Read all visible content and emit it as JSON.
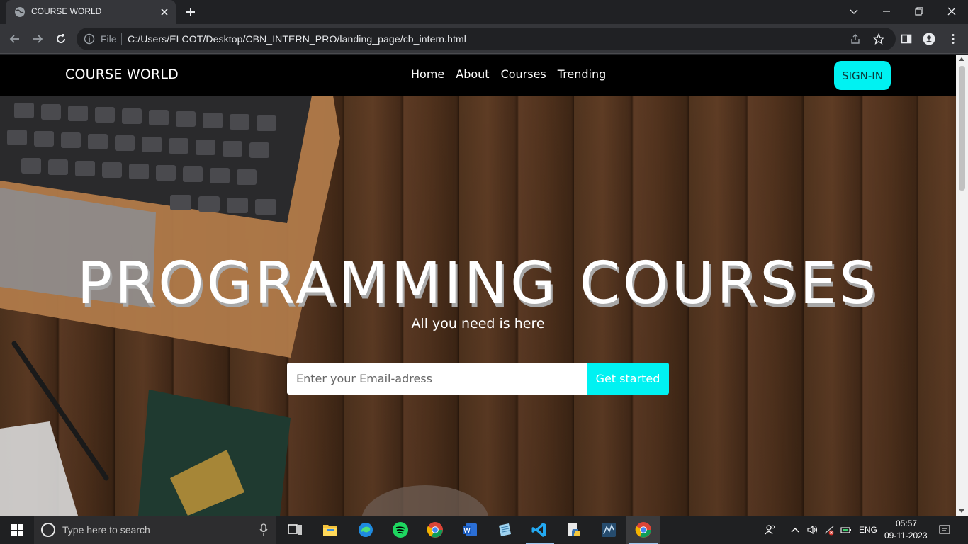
{
  "browser": {
    "tab_title": "COURSE WORLD",
    "address_scheme": "File",
    "address_url": "C:/Users/ELCOT/Desktop/CBN_INTERN_PRO/landing_page/cb_intern.html"
  },
  "site": {
    "brand": "COURSE WORLD",
    "nav": [
      {
        "label": "Home"
      },
      {
        "label": "About"
      },
      {
        "label": "Courses"
      },
      {
        "label": "Trending"
      }
    ],
    "signin_label": "SIGN-IN"
  },
  "hero": {
    "title": "PROGRAMMING COURSES",
    "subtitle": "All you need is here",
    "email_placeholder": "Enter your Email-adress",
    "cta_label": "Get started"
  },
  "taskbar": {
    "search_placeholder": "Type here to search",
    "apps": [
      "task-view",
      "file-explorer",
      "edge",
      "spotify",
      "chrome",
      "word",
      "notepad",
      "vscode",
      "python",
      "mysql-workbench",
      "chrome-active"
    ],
    "language": "ENG",
    "time": "05:57",
    "date": "09-11-2023"
  },
  "colors": {
    "accent": "#00f2f2",
    "navbar": "#000000"
  }
}
